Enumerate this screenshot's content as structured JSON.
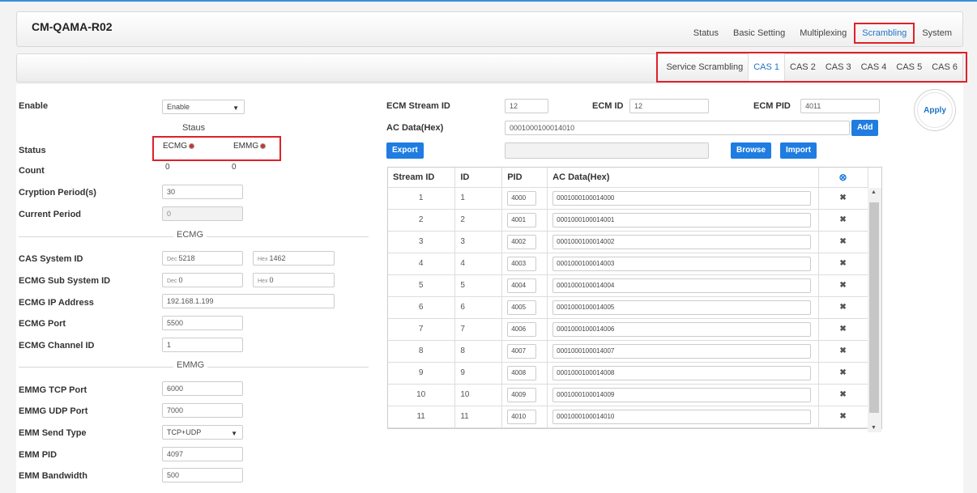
{
  "app": {
    "title": "CM-QAMA-R02"
  },
  "main_nav": [
    "Status",
    "Basic Setting",
    "Multiplexing",
    "Scrambling",
    "System"
  ],
  "main_nav_active": 3,
  "sub_nav": [
    "Service Scrambling",
    "CAS 1",
    "CAS 2",
    "CAS 3",
    "CAS 4",
    "CAS 5",
    "CAS 6"
  ],
  "sub_nav_active": 1,
  "left": {
    "enable_label": "Enable",
    "enable_value": "Enable",
    "staus_heading": "Staus",
    "status_label": "Status",
    "ecmg_status": "ECMG",
    "emmg_status": "EMMG",
    "count_label": "Count",
    "count_ecmg": "0",
    "count_emmg": "0",
    "cryption_label": "Cryption Period(s)",
    "cryption_value": "30",
    "current_label": "Current Period",
    "current_value": "0",
    "ecmg_section": "ECMG",
    "cas_id_label": "CAS System ID",
    "cas_id_dec_prefix": "Dec",
    "cas_id_dec": "5218",
    "cas_id_hex_prefix": "Hex",
    "cas_id_hex": "1462",
    "sub_id_label": "ECMG Sub System ID",
    "sub_id_dec_prefix": "Dec",
    "sub_id_dec": "0",
    "sub_id_hex_prefix": "Hex",
    "sub_id_hex": "0",
    "ecmg_ip_label": "ECMG IP Address",
    "ecmg_ip_value": "192.168.1.199",
    "ecmg_port_label": "ECMG Port",
    "ecmg_port_value": "5500",
    "ecmg_channel_label": "ECMG Channel ID",
    "ecmg_channel_value": "1",
    "emmg_section": "EMMG",
    "emmg_tcp_label": "EMMG TCP Port",
    "emmg_tcp_value": "6000",
    "emmg_udp_label": "EMMG UDP Port",
    "emmg_udp_value": "7000",
    "emm_send_label": "EMM Send Type",
    "emm_send_value": "TCP+UDP",
    "emm_pid_label": "EMM PID",
    "emm_pid_value": "4097",
    "emm_bw_label": "EMM Bandwidth",
    "emm_bw_value": "500"
  },
  "right": {
    "ecm_stream_label": "ECM Stream ID",
    "ecm_stream_value": "12",
    "ecm_id_label": "ECM ID",
    "ecm_id_value": "12",
    "ecm_pid_label": "ECM PID",
    "ecm_pid_value": "4011",
    "ac_label": "AC Data(Hex)",
    "ac_value": "0001000100014010",
    "add_label": "Add",
    "export_label": "Export",
    "browse_label": "Browse",
    "import_label": "Import",
    "apply_label": "Apply",
    "table_headers": [
      "Stream ID",
      "ID",
      "PID",
      "AC Data(Hex)"
    ],
    "rows": [
      [
        "1",
        "1",
        "4000",
        "0001000100014000"
      ],
      [
        "2",
        "2",
        "4001",
        "0001000100014001"
      ],
      [
        "3",
        "3",
        "4002",
        "0001000100014002"
      ],
      [
        "4",
        "4",
        "4003",
        "0001000100014003"
      ],
      [
        "5",
        "5",
        "4004",
        "0001000100014004"
      ],
      [
        "6",
        "6",
        "4005",
        "0001000100014005"
      ],
      [
        "7",
        "7",
        "4006",
        "0001000100014006"
      ],
      [
        "8",
        "8",
        "4007",
        "0001000100014007"
      ],
      [
        "9",
        "9",
        "4008",
        "0001000100014008"
      ],
      [
        "10",
        "10",
        "4009",
        "0001000100014009"
      ],
      [
        "11",
        "11",
        "4010",
        "0001000100014010"
      ]
    ]
  },
  "colors": {
    "accent": "#1f7ce0",
    "highlight": "#e0202a",
    "status_dot": "#cc3333"
  }
}
